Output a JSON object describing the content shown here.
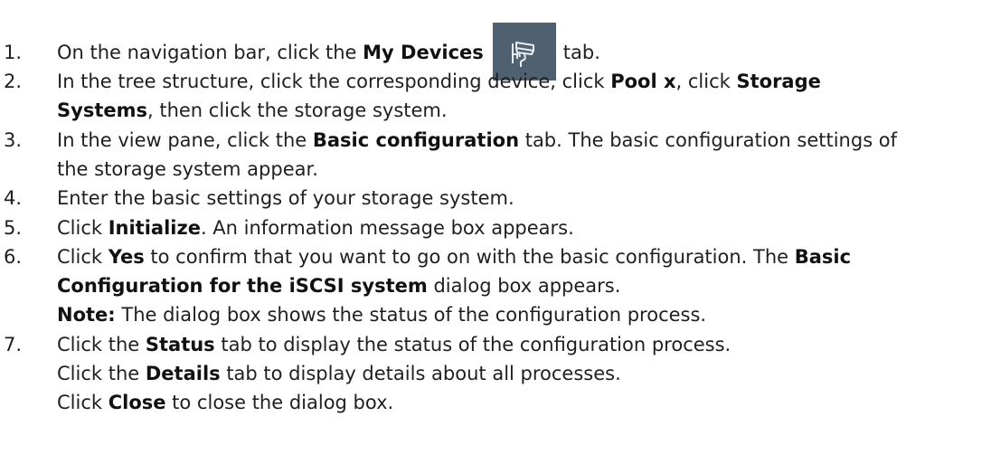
{
  "steps": [
    {
      "number": "1.",
      "lines": [
        [
          "On the navigation bar, click the ",
          "My Devices",
          "tab."
        ]
      ]
    },
    {
      "number": "2.",
      "lines": [
        [
          "In the tree structure, click the corresponding device, click ",
          "Pool x",
          ", click ",
          "Storage"
        ],
        [
          "Systems",
          ", then click the storage system."
        ]
      ]
    },
    {
      "number": "3.",
      "lines": [
        [
          "In the view pane, click the ",
          "Basic configuration",
          " tab. The basic configuration settings of"
        ],
        [
          "the storage system appear."
        ]
      ]
    },
    {
      "number": "4.",
      "lines": [
        [
          "Enter the basic settings of your storage system."
        ]
      ]
    },
    {
      "number": "5.",
      "lines": [
        [
          "Click ",
          "Initialize",
          ". An information message box appears."
        ]
      ]
    },
    {
      "number": "6.",
      "lines": [
        [
          "Click ",
          "Yes",
          " to confirm that you want to go on with the basic configuration. The ",
          "Basic"
        ],
        [
          "Configuration for the iSCSI system",
          " dialog box appears."
        ],
        [
          "Note:",
          " The dialog box shows the status of the configuration process."
        ]
      ]
    },
    {
      "number": "7.",
      "lines": [
        [
          "Click the ",
          "Status",
          " tab to display the status of the configuration process."
        ],
        [
          "Click the ",
          "Details",
          " tab to display details about all processes."
        ],
        [
          "Click ",
          "Close",
          " to close the dialog box."
        ]
      ]
    }
  ],
  "icons": {
    "my_devices": "camera-icon"
  }
}
